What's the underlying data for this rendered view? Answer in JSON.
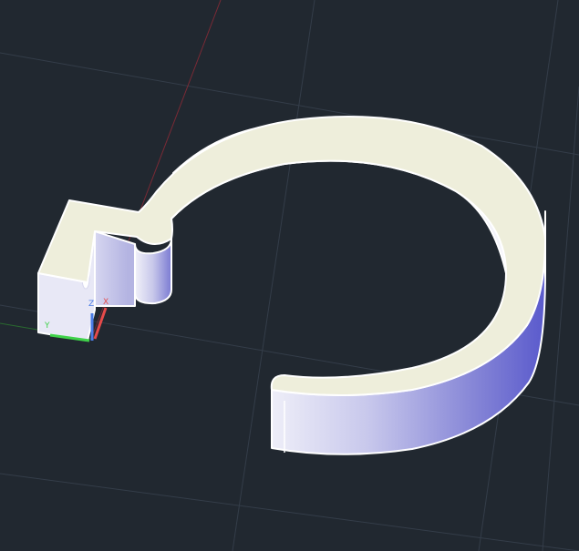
{
  "viewport": {
    "background": "#212830",
    "grid_color": "#343d49",
    "visual_style": "shaded"
  },
  "model": {
    "part": "split-ring-clamp",
    "top_face_color": "#eeeedb",
    "side_face_colors": [
      "#5a5acb",
      "#bfbfe8",
      "#eeeef8"
    ],
    "edge_color": "#ffffff"
  },
  "ucs_icon": {
    "x_label": "X",
    "y_label": "Y",
    "z_label": "Z",
    "x_color": "#e64a4a",
    "y_color": "#3fd24a",
    "z_color": "#4a7ce6"
  }
}
